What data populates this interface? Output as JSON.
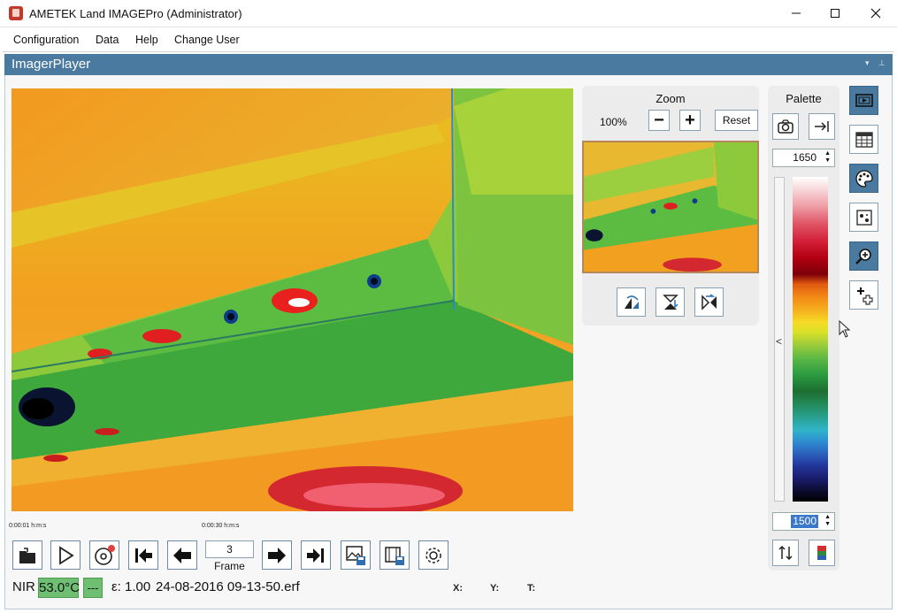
{
  "window": {
    "title": "AMETEK Land IMAGEPro (Administrator)"
  },
  "menu": [
    "Configuration",
    "Data",
    "Help",
    "Change User"
  ],
  "panel": {
    "title": "ImagerPlayer"
  },
  "timeline": {
    "start_label": "0:00:01 h:m:s",
    "end_label": "0:00:30 h:m:s"
  },
  "player": {
    "frame_value": "3",
    "frame_label": "Frame"
  },
  "status": {
    "mode": "NIR",
    "temperature": "53.0°C",
    "secondary": "---",
    "emissivity": "ε: 1.00",
    "filename": "24-08-2016 09-13-50.erf",
    "x_label": "X:",
    "y_label": "Y:",
    "t_label": "T:"
  },
  "zoom": {
    "title": "Zoom",
    "level": "100%",
    "minus_label": "−",
    "plus_label": "+",
    "reset_label": "Reset"
  },
  "palette": {
    "title": "Palette",
    "max_value": "1650",
    "min_value": "1500",
    "slider_arrow": "<"
  },
  "colors": {
    "panel_header": "#4a7aa0",
    "status_green": "#6fbf73",
    "button_border": "#8aa0b4",
    "active_tool": "#4a7aa0"
  },
  "icons": {
    "toolbar": [
      "open-folder-icon",
      "play-icon",
      "record-icon",
      "first-frame-icon",
      "previous-frame-icon",
      "next-frame-icon",
      "last-frame-icon",
      "save-image-icon",
      "save-video-icon",
      "settings-gear-icon"
    ],
    "zoom": [
      "rotate-icon",
      "flip-vertical-icon",
      "flip-horizontal-icon"
    ],
    "palette": [
      "camera-view-icon",
      "arrow-to-line-icon",
      "swap-arrows-icon",
      "palette-swatch-icon"
    ],
    "side": [
      "player-view-icon",
      "table-icon",
      "palette-icon",
      "spots-icon",
      "zoom-tool-icon",
      "add-point-icon"
    ]
  }
}
